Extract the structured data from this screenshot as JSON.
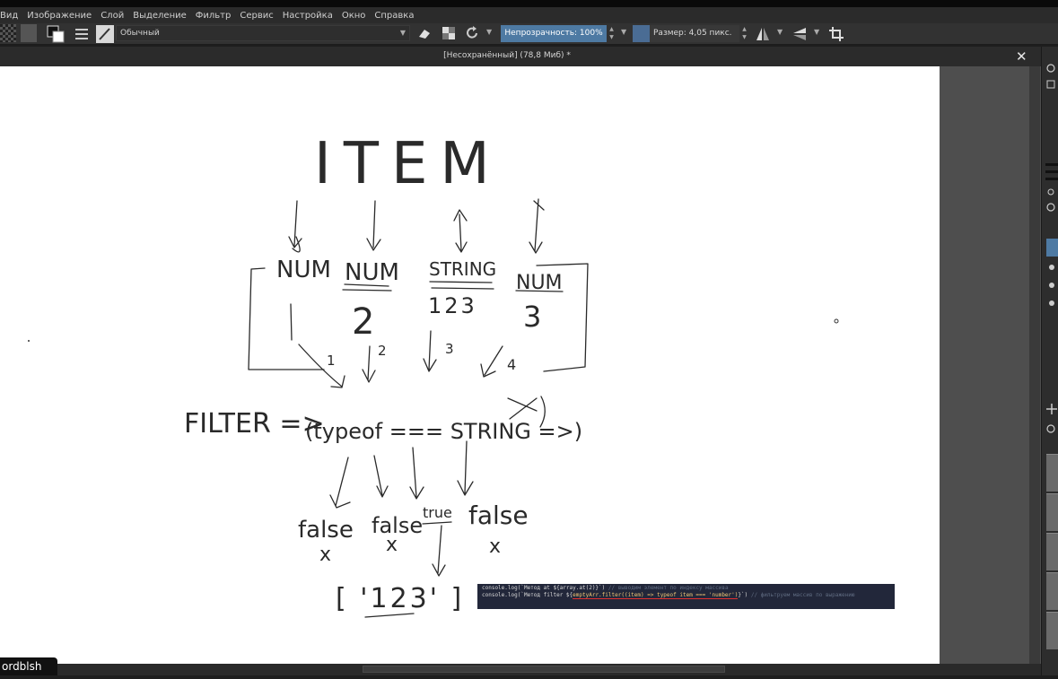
{
  "menu": {
    "items": [
      "Вид",
      "Изображение",
      "Слой",
      "Выделение",
      "Фильтр",
      "Сервис",
      "Настройка",
      "Окно",
      "Справка"
    ]
  },
  "toolbar": {
    "preset_name": "Обычный",
    "opacity_label": "Непрозрачность: 100%",
    "size_label": "Размер: 4,05 пикс."
  },
  "document": {
    "tab_title": "[Несохранённый]  (78,8 Миб) *",
    "close_glyph": "✕"
  },
  "drawing": {
    "title": "ITEM",
    "types": [
      "NUM",
      "NUM",
      "STRING",
      "NUM"
    ],
    "values": [
      "1",
      "2",
      "123",
      "3"
    ],
    "indices": [
      "1",
      "2",
      "3",
      "4"
    ],
    "filter_label": "FILTER =>",
    "condition": "(typeof === STRING =>)",
    "results": [
      "false",
      "false",
      "true",
      "false"
    ],
    "marks": [
      "x",
      "x",
      "x"
    ],
    "output": "[ '123' ]"
  },
  "code_snippet": {
    "line1": "console.log(`Метод at ${array.at(2)}`)",
    "line1_comment": "// выводим элемент по индексу массива",
    "line2_start": "console.log(`Метод filter ${",
    "line2_expr": "emptyArr.filter((item) => typeof item === 'number')",
    "line2_end": "}`)",
    "line2_comment": "// фильтруем массив по выражению"
  },
  "tooltip": {
    "text": "ordblsh"
  },
  "colors": {
    "accent": "#4e7aa3",
    "menubar": "#2b2b2b",
    "canvas": "#ffffff",
    "code_bg": "#22273a"
  }
}
